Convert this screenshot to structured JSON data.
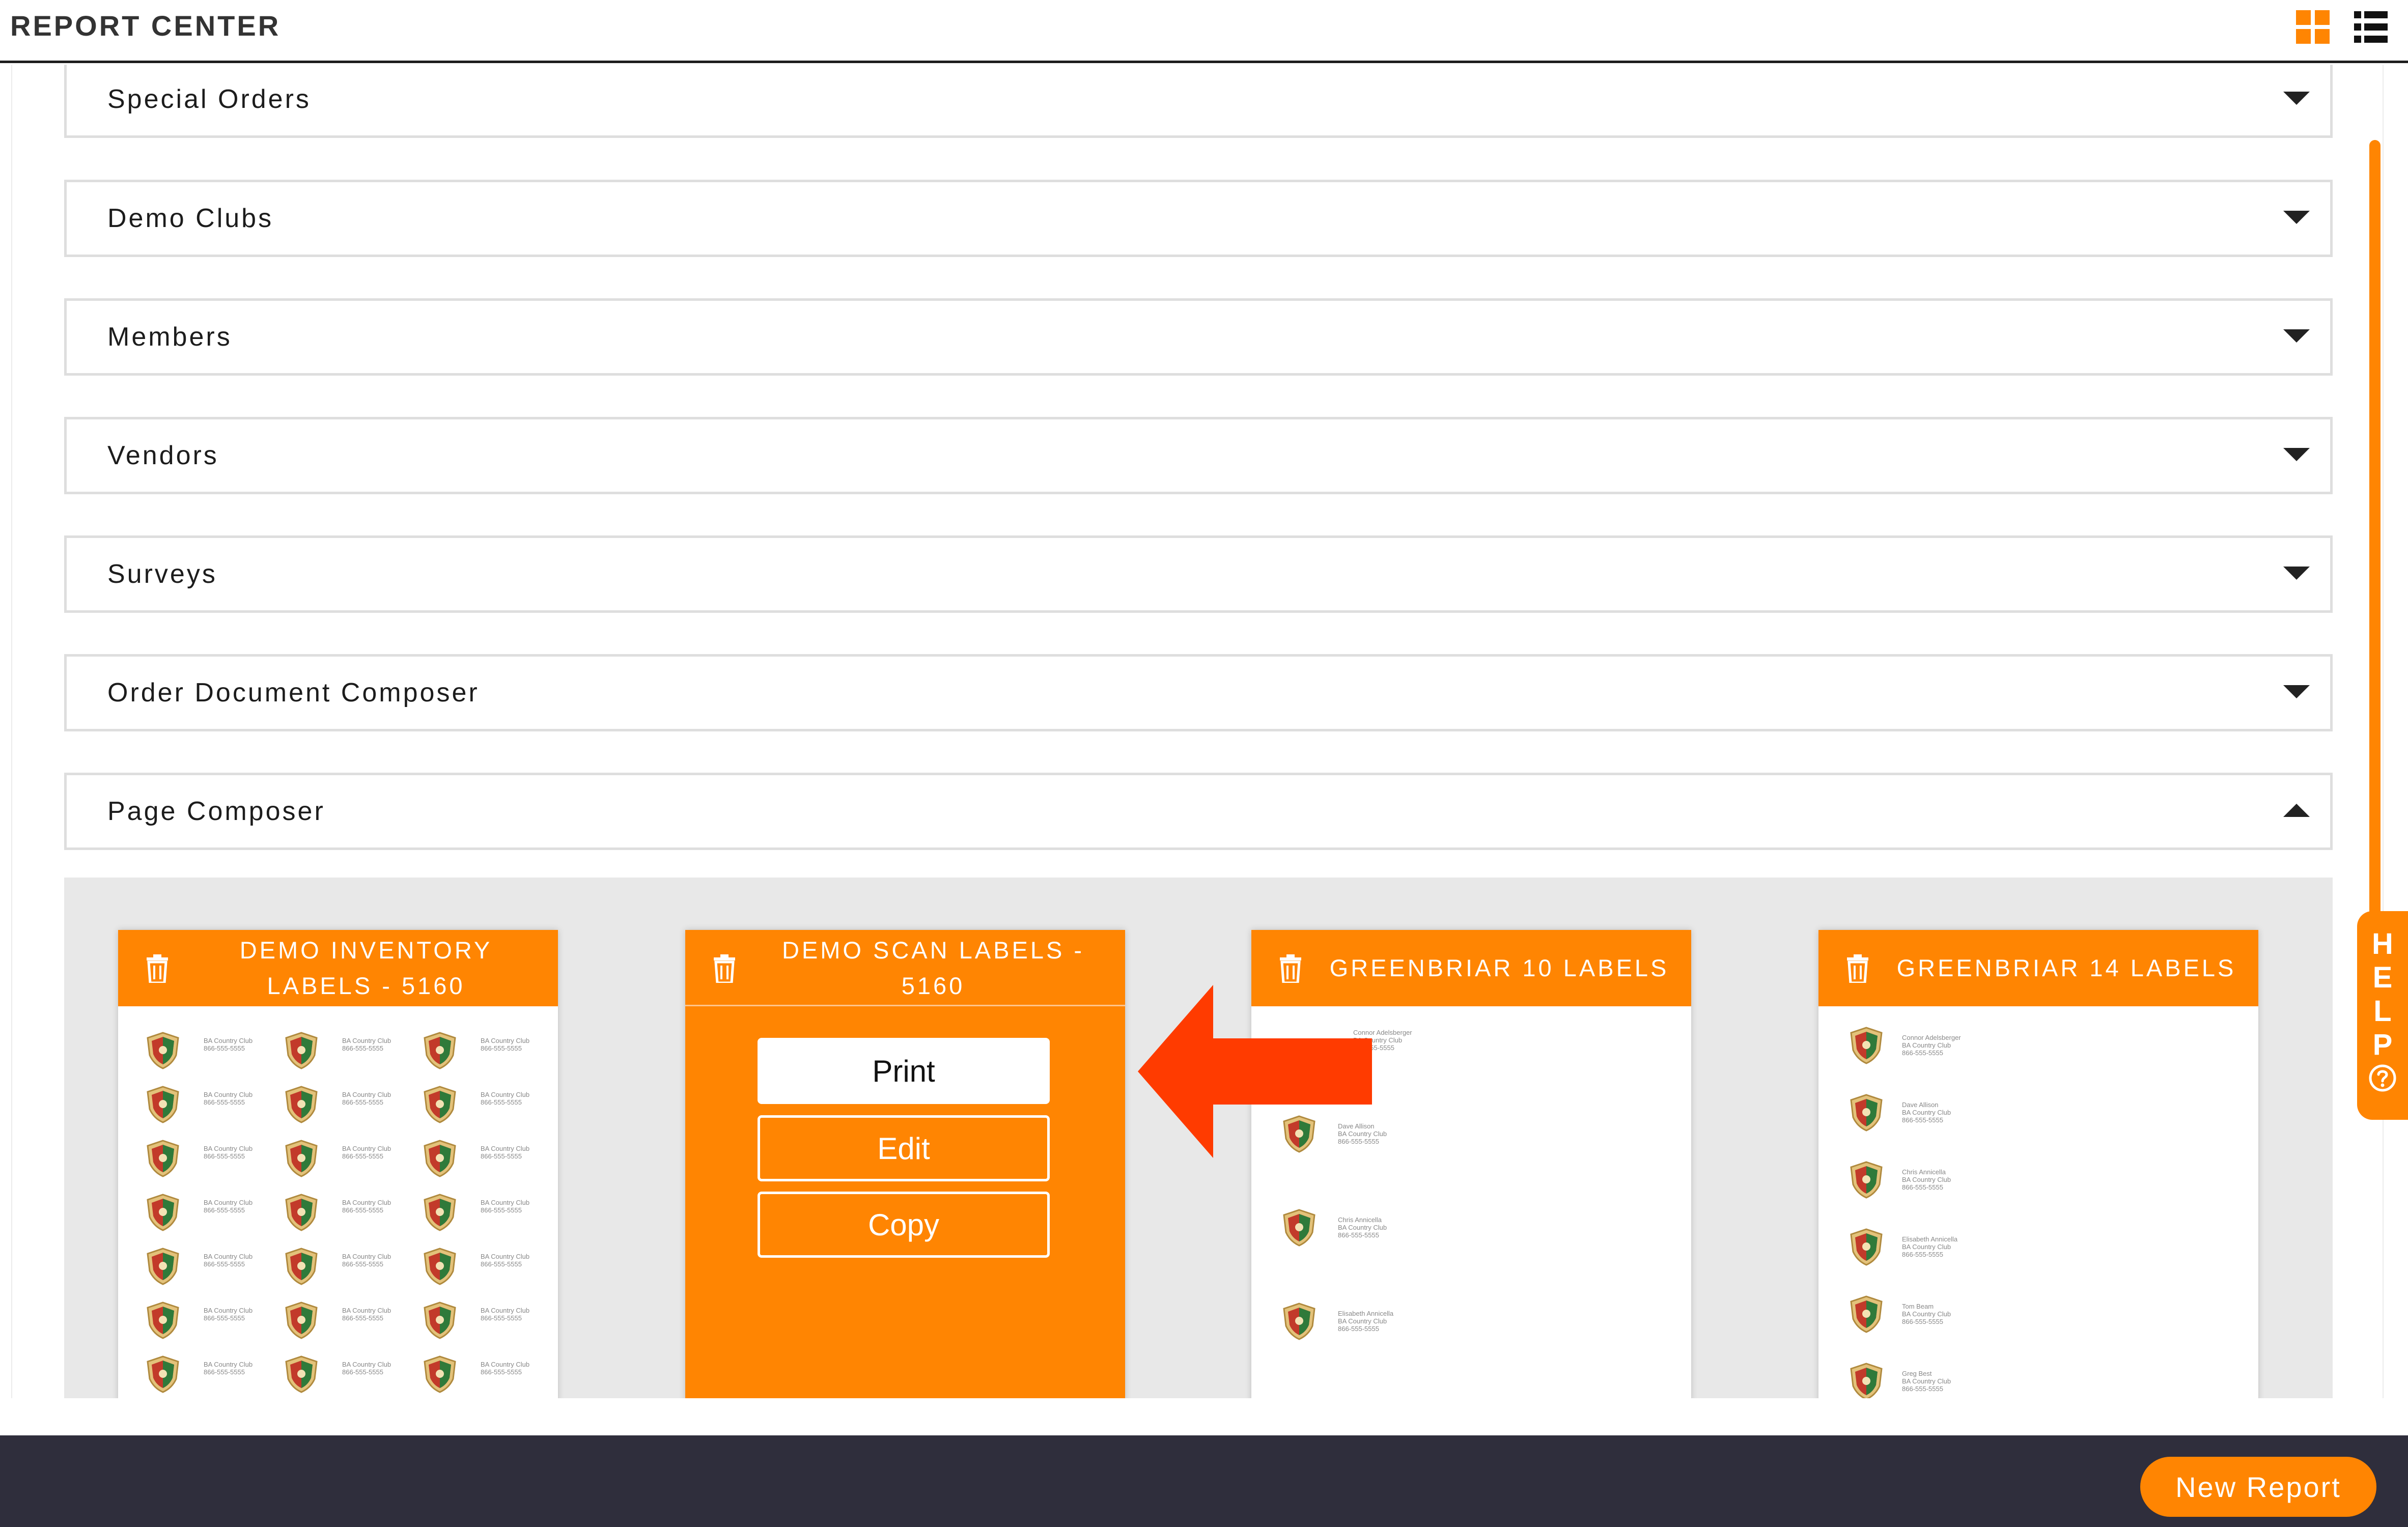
{
  "header": {
    "title": "REPORT CENTER"
  },
  "accordions": [
    {
      "label": "Special Orders",
      "state": "collapsed"
    },
    {
      "label": "Demo Clubs",
      "state": "collapsed"
    },
    {
      "label": "Members",
      "state": "collapsed"
    },
    {
      "label": "Vendors",
      "state": "collapsed"
    },
    {
      "label": "Surveys",
      "state": "collapsed"
    },
    {
      "label": "Order Document Composer",
      "state": "collapsed"
    },
    {
      "label": "Page Composer",
      "state": "expanded"
    }
  ],
  "cards": [
    {
      "title": "DEMO INVENTORY LABELS - 5160"
    },
    {
      "title": "DEMO SCAN LABELS - 5160",
      "actions": {
        "print": "Print",
        "edit": "Edit",
        "copy": "Copy"
      }
    },
    {
      "title": "GREENBRIAR 10 LABELS"
    },
    {
      "title": "GREENBRIAR 14 LABELS"
    }
  ],
  "label_sheet": {
    "club": "BA Country Club",
    "phone": "866-555-5555",
    "names_10": [
      "Connor Adelsberger",
      "Dave Allison",
      "Chris Annicella",
      "Elisabeth Annicella"
    ],
    "names_14": [
      "Connor Adelsberger",
      "Dave Allison",
      "Chris Annicella",
      "Elisabeth Annicella",
      "Tom Beam",
      "Greg Best"
    ]
  },
  "help": {
    "letters": "H E L P",
    "icon": "question-circle-icon"
  },
  "footer": {
    "new_report": "New Report"
  },
  "colors": {
    "accent": "#ff8502",
    "footer_bg": "#2f2e3c",
    "arrow": "#ff3b00"
  }
}
